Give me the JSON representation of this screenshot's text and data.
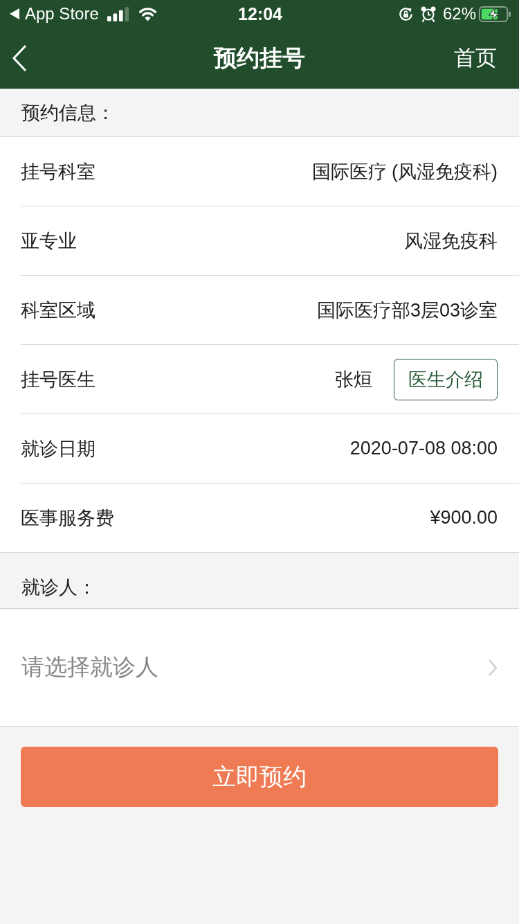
{
  "status_bar": {
    "back_app": "App Store",
    "time": "12:04",
    "battery": "62%"
  },
  "nav_bar": {
    "title": "预约挂号",
    "right_action": "首页"
  },
  "sections": [
    {
      "title": "预约信息：",
      "rows": [
        {
          "kind": "value",
          "label": "挂号科室",
          "value": "国际医疗 (风湿免疫科)"
        },
        {
          "kind": "value",
          "label": "亚专业",
          "value": "风湿免疫科"
        },
        {
          "kind": "value",
          "label": "科室区域",
          "value": "国际医疗部3层03诊室"
        },
        {
          "kind": "doctor",
          "label": "挂号医生",
          "value": "张烜",
          "button": "医生介绍"
        },
        {
          "kind": "value",
          "label": "就诊日期",
          "value": "2020-07-08 08:00"
        },
        {
          "kind": "value",
          "label": "医事服务费",
          "value": "¥900.00"
        }
      ]
    },
    {
      "title": "就诊人：",
      "rows": [
        {
          "kind": "picker",
          "placeholder": "请选择就诊人"
        }
      ]
    }
  ],
  "submit_button": "立即预约"
}
